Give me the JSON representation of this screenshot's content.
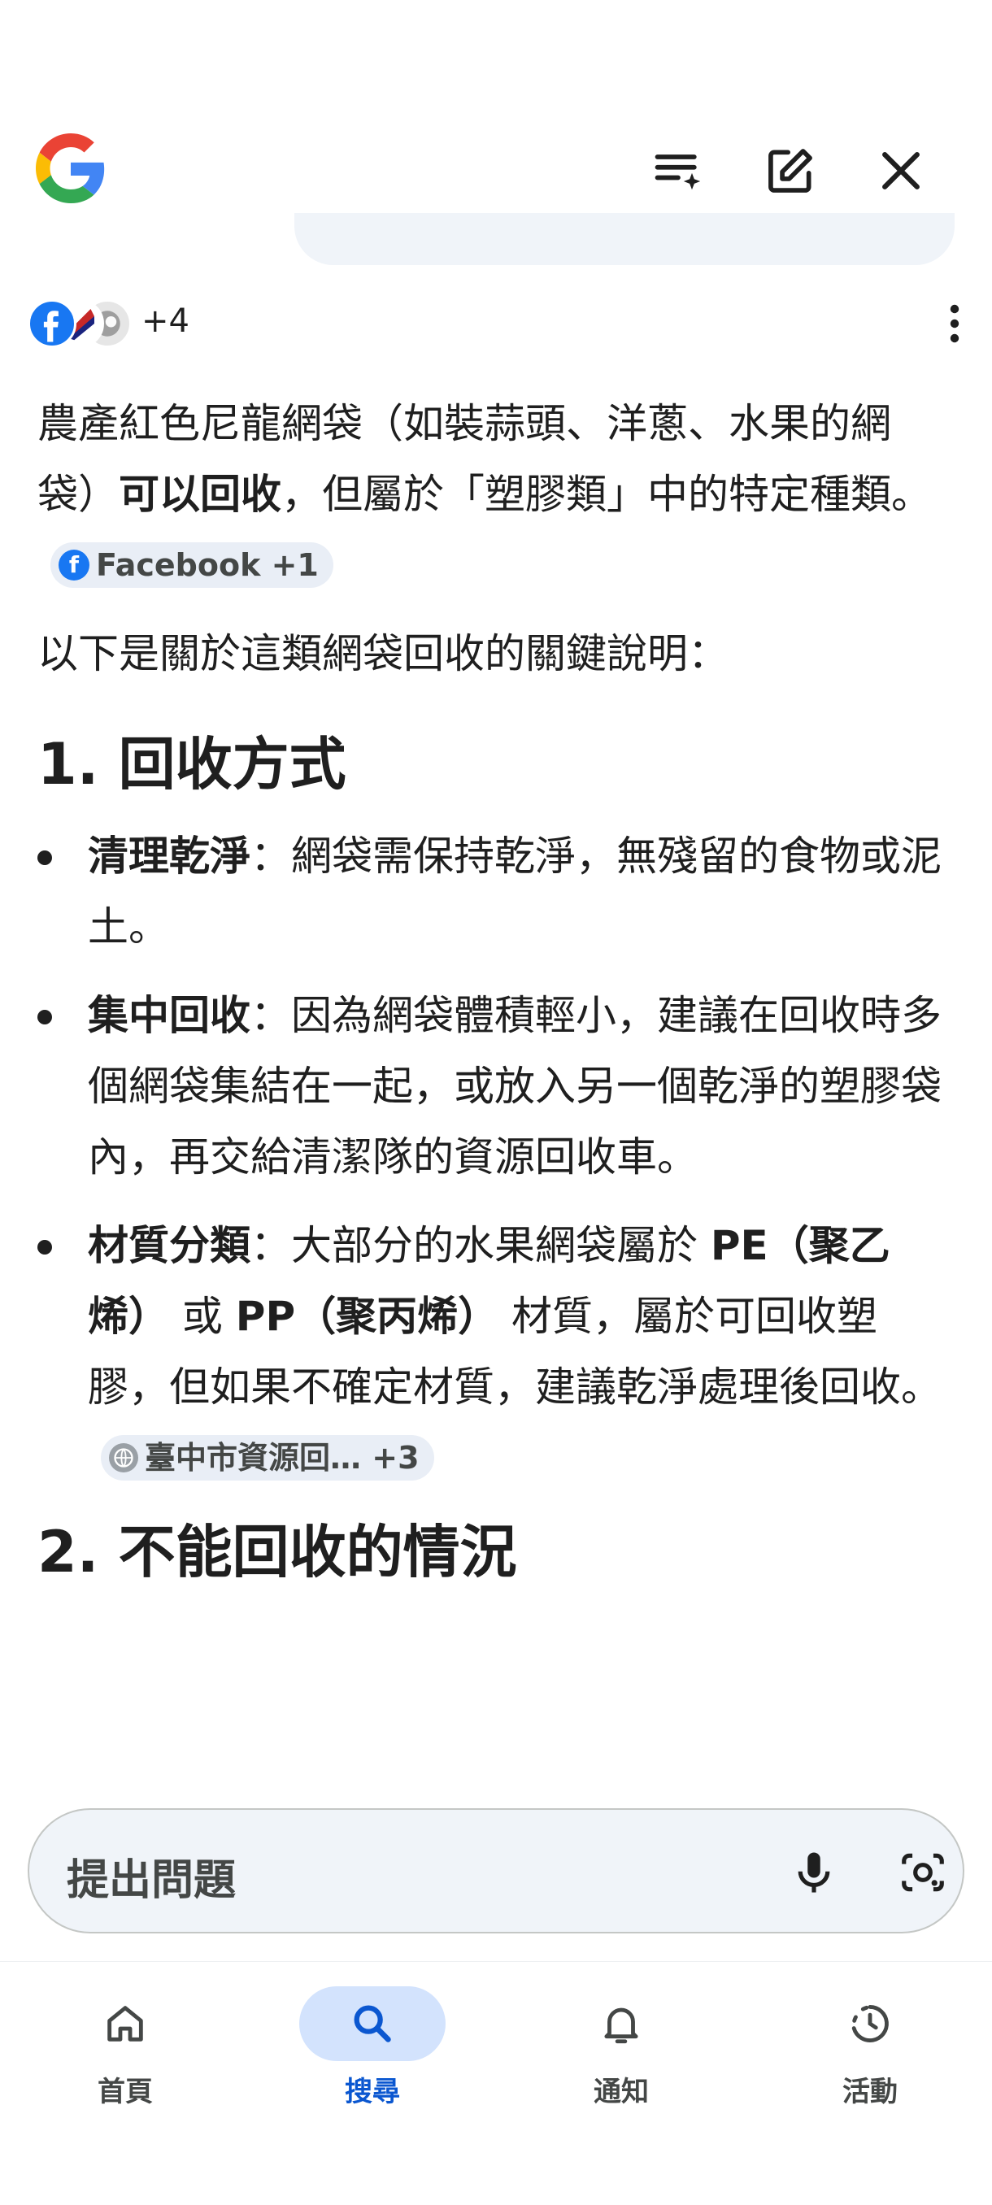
{
  "header": {
    "logo_icon": "google-g-icon",
    "actions": [
      {
        "name": "sparkle-list-icon"
      },
      {
        "name": "edit-icon"
      },
      {
        "name": "close-icon"
      }
    ]
  },
  "sources": {
    "icons": [
      "facebook-icon",
      "source-flag-icon",
      "source-globe-icon"
    ],
    "extra_count": "+4"
  },
  "content": {
    "p1_a": "農產紅色尼龍網袋（如裝蒜頭、洋蔥、水果的網袋）",
    "p1_bold": "可以回收",
    "p1_b": "，但屬於「塑膠類」中的特定種類。",
    "chip1": "Facebook +1",
    "intro": "以下是關於這類網袋回收的關鍵說明：",
    "section1_title": "1. 回收方式",
    "bullets": [
      {
        "bold": "清理乾淨",
        "text": "：網袋需保持乾淨，無殘留的食物或泥土。"
      },
      {
        "bold": "集中回收",
        "text": "：因為網袋體積輕小，建議在回收時多個網袋集結在一起，或放入另一個乾淨的塑膠袋內，再交給清潔隊的資源回收車。"
      },
      {
        "bold": "材質分類",
        "text_a": "：大部分的水果網袋屬於 ",
        "b1": "PE（聚乙烯）",
        "mid": " 或 ",
        "b2": "PP（聚丙烯）",
        "text_b": " 材質，屬於可回收塑膠，但如果不確定材質，建議乾淨處理後回收。",
        "chip": "臺中市資源回…  +3"
      }
    ],
    "section2_title": "2. 不能回收的情況"
  },
  "ask": {
    "placeholder": "提出問題"
  },
  "nav": [
    {
      "label": "首頁",
      "icon": "home-icon",
      "active": false
    },
    {
      "label": "搜尋",
      "icon": "search-icon",
      "active": true
    },
    {
      "label": "通知",
      "icon": "bell-icon",
      "active": false
    },
    {
      "label": "活動",
      "icon": "activity-icon",
      "active": false
    }
  ],
  "colors": {
    "accent": "#0b57d0",
    "active_pill": "#d3e3fd",
    "chip_bg": "#e9eef6",
    "text": "#1f1f1f"
  }
}
